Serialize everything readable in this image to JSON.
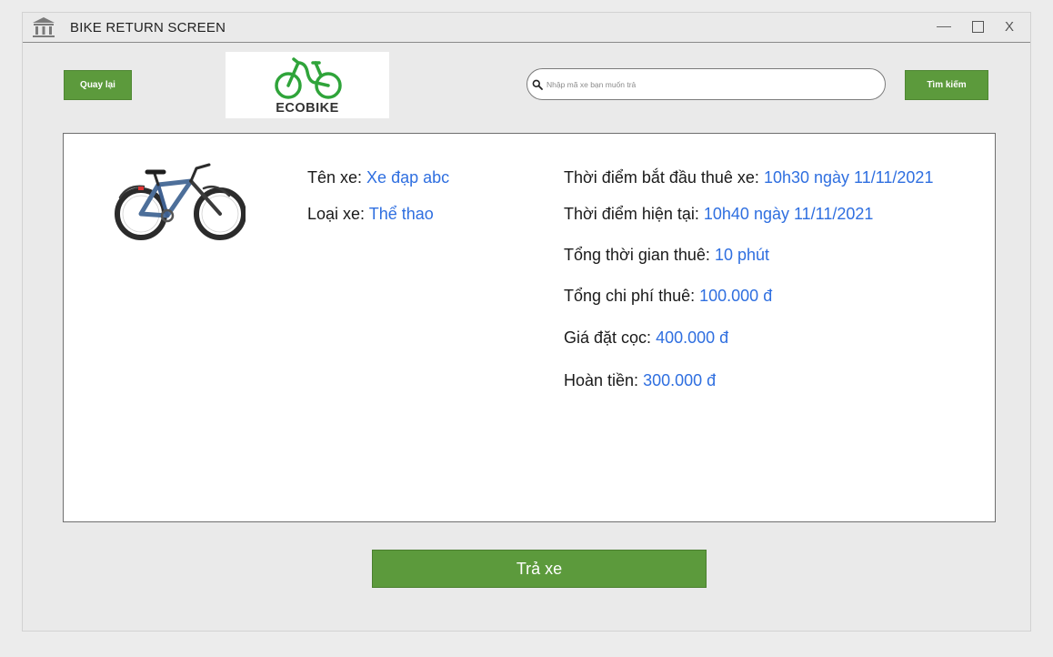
{
  "window": {
    "title": "BIKE RETURN SCREEN",
    "close_label": "X"
  },
  "header": {
    "back_label": "Quay lại",
    "logo": {
      "part1": "ECO",
      "part2": "BIKE"
    },
    "search": {
      "placeholder": "Nhập mã xe bạn muốn trả",
      "value": ""
    },
    "search_label": "Tìm kiếm"
  },
  "bike": {
    "name": {
      "label": "Tên xe:",
      "value": "Xe đạp abc"
    },
    "type": {
      "label": "Loại xe:",
      "value": "Thể thao"
    }
  },
  "rental": {
    "start_time": {
      "label": "Thời điểm bắt đầu thuê xe:",
      "value": "10h30 ngày 11/11/2021"
    },
    "current_time": {
      "label": "Thời điểm hiện tại:",
      "value": "10h40 ngày 11/11/2021"
    },
    "total_duration": {
      "label": "Tổng thời gian thuê:",
      "value": "10 phút"
    },
    "total_cost": {
      "label": "Tổng chi phí thuê:",
      "value": "100.000 đ"
    },
    "deposit": {
      "label": "Giá đặt cọc:",
      "value": "400.000 đ"
    },
    "refund": {
      "label": "Hoàn tiền:",
      "value": "300.000 đ"
    }
  },
  "actions": {
    "return_label": "Trả xe"
  },
  "colors": {
    "accent_green": "#5c9a3c",
    "value_blue": "#2f6fe0",
    "logo_green": "#2fa43a"
  }
}
